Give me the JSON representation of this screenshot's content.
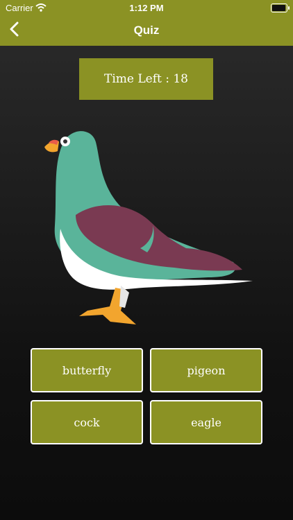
{
  "status": {
    "carrier": "Carrier",
    "time": "1:12 PM"
  },
  "nav": {
    "title": "Quiz"
  },
  "timer": {
    "label": "Time Left : 18"
  },
  "question": {
    "image": "pigeon-illustration"
  },
  "answers": [
    {
      "label": "butterfly"
    },
    {
      "label": "pigeon"
    },
    {
      "label": "cock"
    },
    {
      "label": "eagle"
    }
  ],
  "colors": {
    "accent": "#8b9224",
    "background": "#1a1a1a"
  }
}
